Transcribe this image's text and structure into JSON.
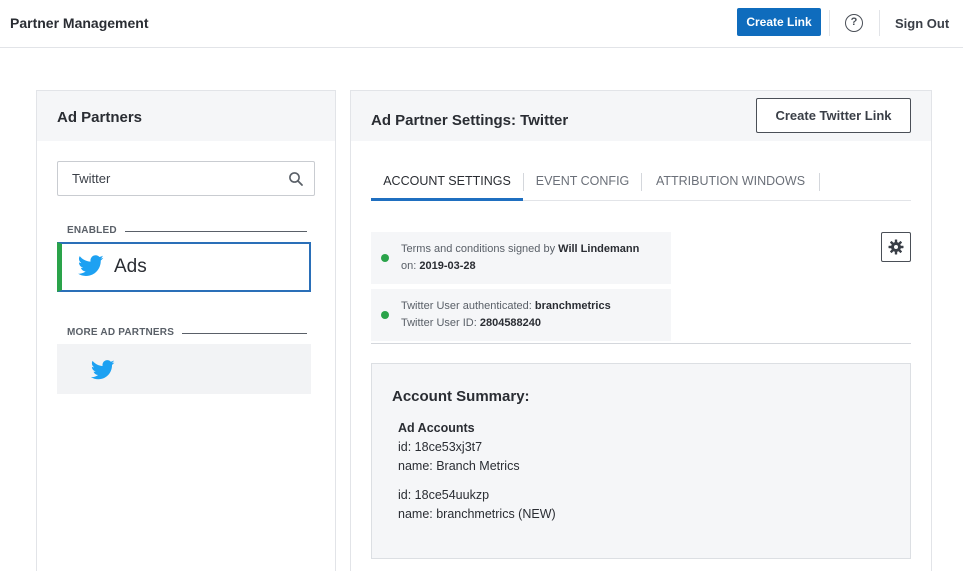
{
  "header": {
    "title": "Partner Management",
    "create_link_label": "Create Link",
    "help_label": "?",
    "sign_out_label": "Sign Out",
    "accent_color": "#0f6cbd"
  },
  "left": {
    "title": "Ad Partners",
    "search": {
      "value": "Twitter",
      "placeholder": ""
    },
    "enabled_label": "ENABLED",
    "enabled_partner": {
      "name": "Ads",
      "icon": "twitter-bird-icon"
    },
    "more_label": "MORE AD PARTNERS",
    "more_partner": {
      "icon": "twitter-bird-icon"
    }
  },
  "right": {
    "title": "Ad Partner Settings: Twitter",
    "create_twitter_link_label": "Create Twitter Link",
    "tabs": [
      {
        "label": "ACCOUNT SETTINGS",
        "active": true
      },
      {
        "label": "EVENT CONFIG",
        "active": false
      },
      {
        "label": "ATTRIBUTION WINDOWS",
        "active": false
      }
    ],
    "terms": {
      "line1_prefix": "Terms and conditions signed by ",
      "signer": "Will Lindemann",
      "line2_prefix": "on: ",
      "date": "2019-03-28"
    },
    "auth": {
      "line1_prefix": "Twitter User authenticated: ",
      "user": "branchmetrics",
      "line2_prefix": "Twitter User ID: ",
      "user_id": "2804588240"
    },
    "summary": {
      "title": "Account Summary:",
      "accounts_heading": "Ad Accounts",
      "accounts": [
        {
          "id_line": "id: 18ce53xj3t7",
          "name_line": "name: Branch Metrics"
        },
        {
          "id_line": "id: 18ce54uukzp",
          "name_line": "name: branchmetrics (NEW)"
        }
      ]
    },
    "status_color": "#2aa34a"
  }
}
